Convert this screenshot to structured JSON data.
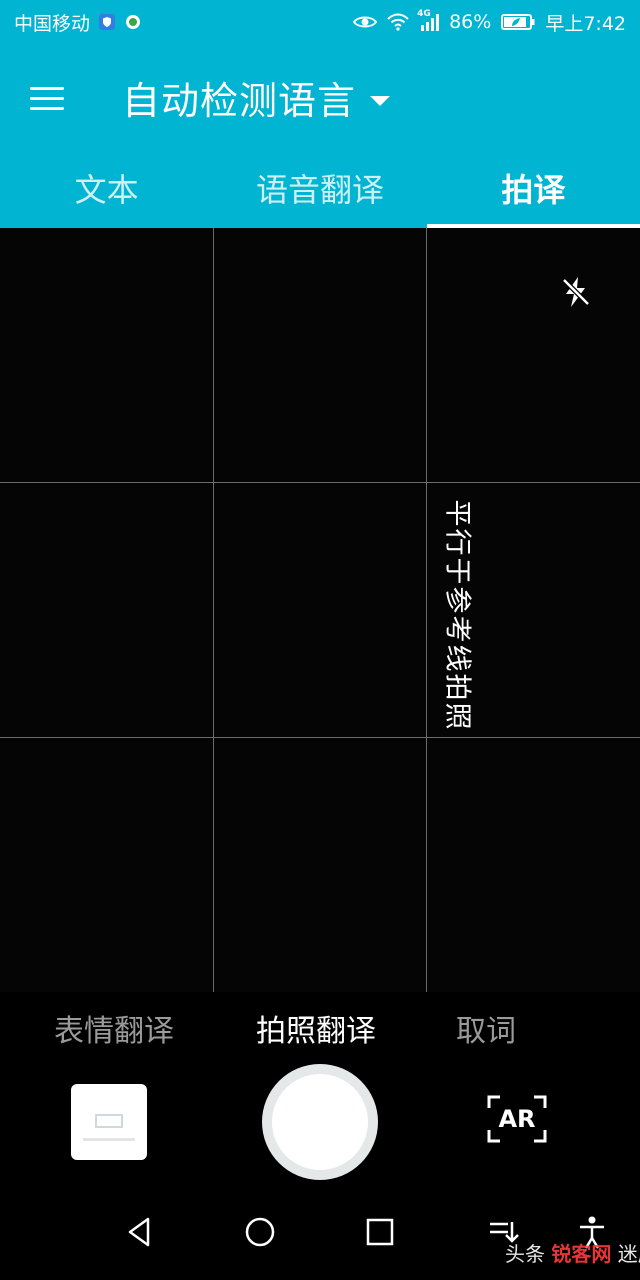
{
  "status_bar": {
    "carrier": "中国移动",
    "network_label": "4G",
    "battery": "86%",
    "time": "早上7:42"
  },
  "header": {
    "language_title": "自动检测语言",
    "tabs": [
      {
        "label": "文本",
        "active": false
      },
      {
        "label": "语音翻译",
        "active": false
      },
      {
        "label": "拍译",
        "active": true
      }
    ]
  },
  "camera": {
    "hint_text": "平行于参考线拍照",
    "flash_icon": "flash-off-icon"
  },
  "modes": [
    {
      "label": "表情翻译",
      "active": false
    },
    {
      "label": "拍照翻译",
      "active": true
    },
    {
      "label": "取词",
      "active": false
    }
  ],
  "controls": {
    "ar_label": "AR"
  },
  "watermark": {
    "prefix": "头条",
    "brand": "锐客网",
    "suffix": "迷鹿"
  },
  "colors": {
    "accent": "#00b4d2",
    "background": "#000000"
  }
}
